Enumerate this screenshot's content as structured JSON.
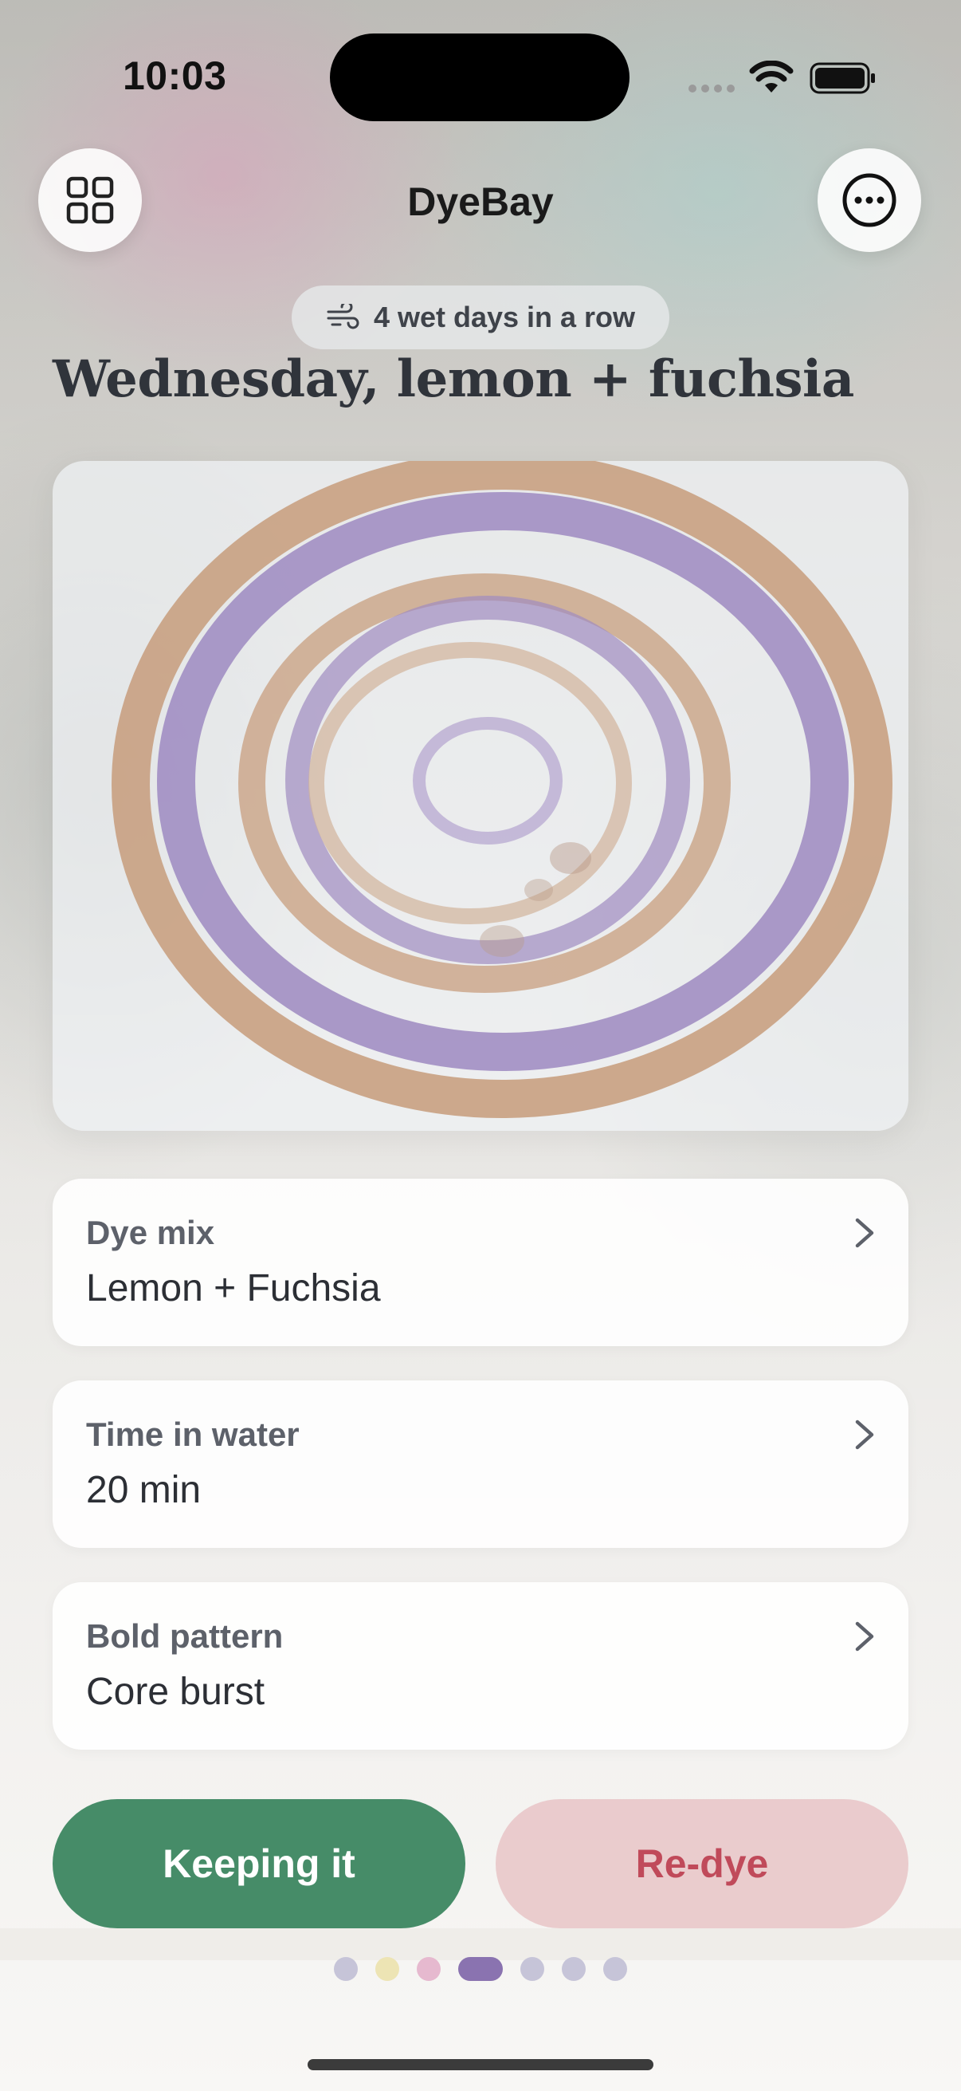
{
  "status_bar": {
    "time": "10:03"
  },
  "nav": {
    "title": "DyeBay",
    "left_icon": "grid-icon",
    "right_icon": "more-icon"
  },
  "streak_chip": {
    "icon": "wind-icon",
    "text": "4 wet days in a row"
  },
  "headline": "Wednesday, lemon + fuchsia",
  "colors": {
    "tan": "#c9a283",
    "lavender": "#9f8cc1",
    "green": "#468c68",
    "redye_bg": "#e8c8ca",
    "redye_text": "#c04a5a"
  },
  "details": [
    {
      "label": "Dye mix",
      "value": "Lemon + Fuchsia"
    },
    {
      "label": "Time in water",
      "value": "20 min"
    },
    {
      "label": "Bold pattern",
      "value": "Core burst"
    }
  ],
  "actions": {
    "keep": "Keeping it",
    "redye": "Re-dye"
  },
  "page_dots": {
    "colors": [
      "#c6c4d8",
      "#ede4b4",
      "#e6b9cf",
      "#8a73b0",
      "#c6c4d8",
      "#c6c4d8",
      "#c6c4d8"
    ],
    "active_index": 3
  }
}
